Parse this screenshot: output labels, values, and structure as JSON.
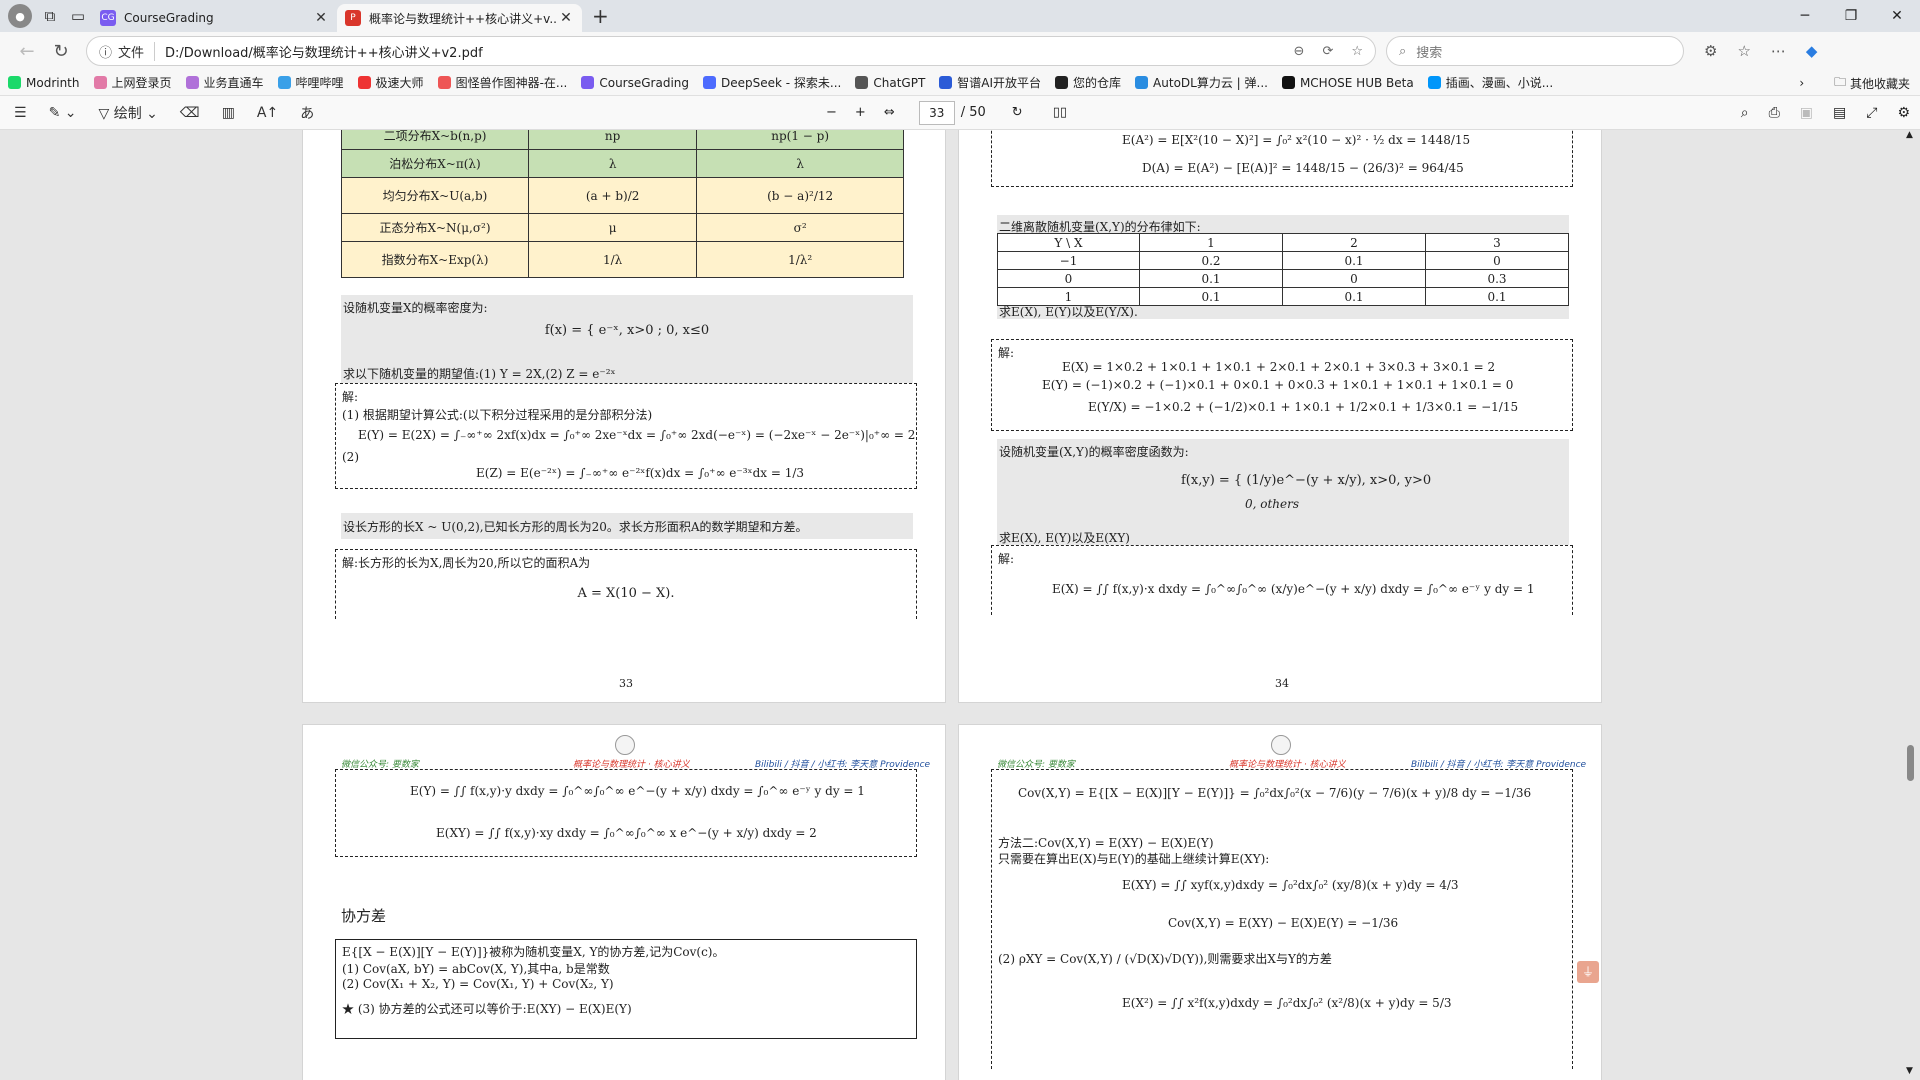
{
  "browser": {
    "tabs": [
      {
        "title": "CourseGrading"
      },
      {
        "title": "概率论与数理统计++核心讲义+v..."
      }
    ],
    "url_prefix": "文件",
    "url": "D:/Download/概率论与数理统计++核心讲义+v2.pdf",
    "search_placeholder": "搜索",
    "bookmarks": [
      "Modrinth",
      "上网登录页",
      "业务直通车",
      "哔哩哔哩",
      "极速大师",
      "图怪兽作图神器-在...",
      "CourseGrading",
      "DeepSeek - 探索未...",
      "ChatGPT",
      "智谱AI开放平台",
      "您的仓库",
      "AutoDL算力云 | 弹...",
      "MCHOSE HUB Beta",
      "插画、漫画、小说..."
    ],
    "bookmarks_other": "其他收藏夹"
  },
  "pdf_toolbar": {
    "draw_label": "绘制",
    "page": "33",
    "total": "/ 50"
  },
  "page33": {
    "table_rows": [
      [
        "二项分布X~b(n,p)",
        "np",
        "np(1 − p)"
      ],
      [
        "泊松分布X~π(λ)",
        "λ",
        "λ"
      ],
      [
        "均匀分布X~U(a,b)",
        "(a + b)/2",
        "(b − a)²/12"
      ],
      [
        "正态分布X~N(μ,σ²)",
        "μ",
        "σ²"
      ],
      [
        "指数分布X~Exp(λ)",
        "1/λ",
        "1/λ²"
      ]
    ],
    "q1": "设随机变量X的概率密度为:",
    "q1_f": "f(x) = { e⁻ˣ, x>0 ;  0, x≤0",
    "q1_ask": "求以下随机变量的期望值:(1) Y = 2X,(2) Z = e⁻²ˣ",
    "a1_h": "解:",
    "a1_1": "(1) 根据期望计算公式:(以下积分过程采用的是分部积分法)",
    "a1_2": "E(Y) = E(2X) = ∫₋∞⁺∞ 2xf(x)dx = ∫₀⁺∞ 2xe⁻ˣdx = ∫₀⁺∞ 2xd(−e⁻ˣ) = (−2xe⁻ˣ − 2e⁻ˣ)|₀⁺∞ = 2",
    "a1_3": "(2)",
    "a1_4": "E(Z) = E(e⁻²ˣ) = ∫₋∞⁺∞ e⁻²ˣf(x)dx = ∫₀⁺∞ e⁻³ˣdx = 1/3",
    "q2": "设长方形的长X ~ U(0,2),已知长方形的周长为20。求长方形面积A的数学期望和方差。",
    "a2_1": "解:长方形的长为X,周长为20,所以它的面积A为",
    "a2_2": "A = X(10 − X).",
    "page_no": "33"
  },
  "page34": {
    "top1": "E(A²) = E[X²(10 − X)²] = ∫₀² x²(10 − x)² · ½ dx = 1448/15",
    "top2": "D(A) = E(A²) − [E(A)]² = 1448/15 − (26/3)² = 964/45",
    "q3": "二维离散随机变量(X,Y)的分布律如下:",
    "dist_head": [
      "Y \\ X",
      "1",
      "2",
      "3"
    ],
    "dist_rows": [
      [
        "−1",
        "0.2",
        "0.1",
        "0"
      ],
      [
        "0",
        "0.1",
        "0",
        "0.3"
      ],
      [
        "1",
        "0.1",
        "0.1",
        "0.1"
      ]
    ],
    "q3_ask": "求E(X), E(Y)以及E(Y/X).",
    "a3_h": "解:",
    "a3_1": "E(X) = 1×0.2 + 1×0.1 + 1×0.1 + 2×0.1 + 2×0.1 + 3×0.3 + 3×0.1 = 2",
    "a3_2": "E(Y) = (−1)×0.2 + (−1)×0.1 + 0×0.1 + 0×0.3 + 1×0.1 + 1×0.1 + 1×0.1 = 0",
    "a3_3": "E(Y/X) = −1×0.2 + (−1/2)×0.1 + 1×0.1 + 1/2×0.1 + 1/3×0.1 = −1/15",
    "q4": "设随机变量(X,Y)的概率密度函数为:",
    "q4_f1": "f(x,y) = { (1/y)e^−(y + x/y), x>0, y>0",
    "q4_f2": "0,            others",
    "q4_ask": "求E(X), E(Y)以及E(XY)",
    "a4_h": "解:",
    "a4_1": "E(X) = ∫∫ f(x,y)·x dxdy = ∫₀^∞∫₀^∞ (x/y)e^−(y + x/y) dxdy = ∫₀^∞ e⁻ʸ y dy = 1",
    "page_no": "34"
  },
  "page35": {
    "hdr_l": "微信公众号: 要数家",
    "hdr_m": "概率论与数理统计 · 核心讲义",
    "hdr_r": "Bilibili / 抖音 / 小红书: 李天意 Providence",
    "b1": "E(Y) = ∫∫ f(x,y)·y dxdy = ∫₀^∞∫₀^∞ e^−(y + x/y) dxdy = ∫₀^∞ e⁻ʸ y dy = 1",
    "b2": "E(XY) = ∫∫ f(x,y)·xy dxdy = ∫₀^∞∫₀^∞ x e^−(y + x/y) dxdy = 2",
    "sec": "协方差",
    "d1": "E{[X − E(X)][Y − E(Y)]}被称为随机变量X, Y的协方差,记为Cov(c)。",
    "d2": "(1) Cov(aX, bY) = abCov(X, Y),其中a, b是常数",
    "d3": "(2) Cov(X₁ + X₂, Y) = Cov(X₁, Y) + Cov(X₂, Y)",
    "d4": "★ (3) 协方差的公式还可以等价于:E(XY) − E(X)E(Y)"
  },
  "page36": {
    "hdr_l": "微信公众号: 要数家",
    "hdr_m": "概率论与数理统计 · 核心讲义",
    "hdr_r": "Bilibili / 抖音 / 小红书: 李天意 Providence",
    "c1": "Cov(X,Y) = E{[X − E(X)][Y − E(Y)]} = ∫₀²dx∫₀²(x − 7/6)(y − 7/6)(x + y)/8 dy = −1/36",
    "c2": "方法二:Cov(X,Y) = E(XY) − E(X)E(Y)",
    "c3": "只需要在算出E(X)与E(Y)的基础上继续计算E(XY):",
    "c4": "E(XY) = ∫∫ xyf(x,y)dxdy = ∫₀²dx∫₀² (xy/8)(x + y)dy = 4/3",
    "c5": "Cov(X,Y) = E(XY) − E(X)E(Y) = −1/36",
    "c6": "(2) ρXY = Cov(X,Y) / (√D(X)√D(Y)),则需要求出X与Y的方差",
    "c7": "E(X²) = ∫∫ x²f(x,y)dxdy = ∫₀²dx∫₀² (x²/8)(x + y)dy = 5/3"
  },
  "colors": {
    "green": "#c6e0b4",
    "yellow": "#fff2cc",
    "accent": "#d9362b",
    "blue": "#1f4e9c"
  }
}
